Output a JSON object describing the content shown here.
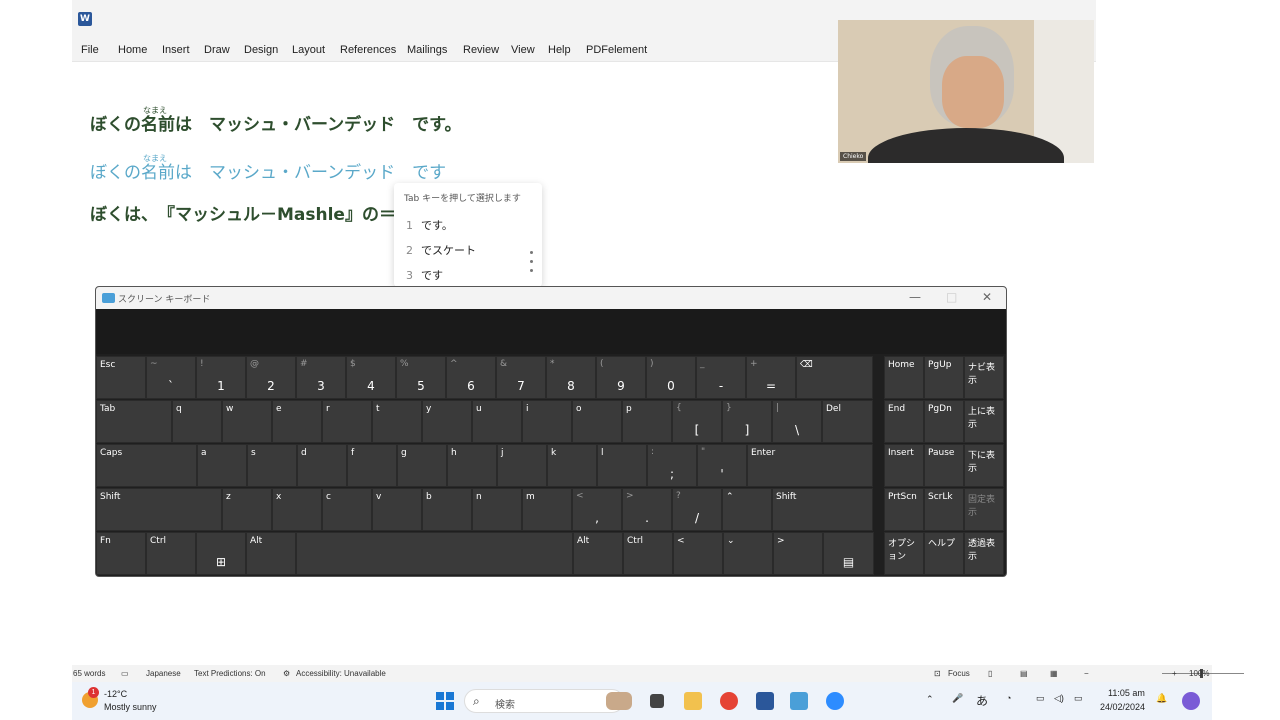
{
  "ribbon": {
    "tabs": [
      "File",
      "Home",
      "Insert",
      "Draw",
      "Design",
      "Layout",
      "References",
      "Mailings",
      "Review",
      "View",
      "Help",
      "PDFelement"
    ]
  },
  "document": {
    "line1": {
      "a": "ぼくの",
      "b": "名前",
      "c": "は　マッシュ・バーンデッド　です。",
      "ruby": "なまえ"
    },
    "line2": {
      "a": "ぼくの",
      "b": "名前",
      "c": "は　マッシュ・バーンデッド　",
      "d": "です",
      "ruby": "なまえ"
    },
    "line3": {
      "text": "ぼくは、　『マッシュル－Mashle』の＝"
    }
  },
  "ime": {
    "hint": "Tab キーを押して選択します",
    "candidates": [
      {
        "num": "1",
        "text": "です。"
      },
      {
        "num": "2",
        "text": "でスケート"
      },
      {
        "num": "3",
        "text": "です"
      }
    ]
  },
  "video": {
    "name": "Chieko"
  },
  "keyboard": {
    "title": "スクリーン キーボード",
    "controls": {
      "minimize": "—",
      "maximize": "□",
      "close": "✕"
    },
    "row1": [
      {
        "up": "",
        "main": "",
        "lbl": "Esc"
      },
      {
        "up": "~",
        "main": "`",
        "lbl": ""
      },
      {
        "up": "!",
        "main": "1",
        "lbl": ""
      },
      {
        "up": "@",
        "main": "2",
        "lbl": ""
      },
      {
        "up": "#",
        "main": "3",
        "lbl": ""
      },
      {
        "up": "$",
        "main": "4",
        "lbl": ""
      },
      {
        "up": "%",
        "main": "5",
        "lbl": ""
      },
      {
        "up": "^",
        "main": "6",
        "lbl": ""
      },
      {
        "up": "&",
        "main": "7",
        "lbl": ""
      },
      {
        "up": "*",
        "main": "8",
        "lbl": ""
      },
      {
        "up": "(",
        "main": "9",
        "lbl": ""
      },
      {
        "up": ")",
        "main": "0",
        "lbl": ""
      },
      {
        "up": "_",
        "main": "-",
        "lbl": ""
      },
      {
        "up": "+",
        "main": "=",
        "lbl": ""
      },
      {
        "up": "",
        "main": "",
        "lbl": "⌫"
      }
    ],
    "row2": [
      {
        "up": "",
        "main": "",
        "lbl": "Tab"
      },
      {
        "up": "",
        "main": "",
        "lbl": "q"
      },
      {
        "up": "",
        "main": "",
        "lbl": "w"
      },
      {
        "up": "",
        "main": "",
        "lbl": "e"
      },
      {
        "up": "",
        "main": "",
        "lbl": "r"
      },
      {
        "up": "",
        "main": "",
        "lbl": "t"
      },
      {
        "up": "",
        "main": "",
        "lbl": "y"
      },
      {
        "up": "",
        "main": "",
        "lbl": "u"
      },
      {
        "up": "",
        "main": "",
        "lbl": "i"
      },
      {
        "up": "",
        "main": "",
        "lbl": "o"
      },
      {
        "up": "",
        "main": "",
        "lbl": "p"
      },
      {
        "up": "{",
        "main": "[",
        "lbl": ""
      },
      {
        "up": "}",
        "main": "]",
        "lbl": ""
      },
      {
        "up": "|",
        "main": "\\",
        "lbl": ""
      },
      {
        "up": "",
        "main": "",
        "lbl": "Del"
      }
    ],
    "row3": [
      {
        "up": "",
        "main": "",
        "lbl": "Caps"
      },
      {
        "up": "",
        "main": "",
        "lbl": "a"
      },
      {
        "up": "",
        "main": "",
        "lbl": "s"
      },
      {
        "up": "",
        "main": "",
        "lbl": "d"
      },
      {
        "up": "",
        "main": "",
        "lbl": "f"
      },
      {
        "up": "",
        "main": "",
        "lbl": "g"
      },
      {
        "up": "",
        "main": "",
        "lbl": "h"
      },
      {
        "up": "",
        "main": "",
        "lbl": "j"
      },
      {
        "up": "",
        "main": "",
        "lbl": "k"
      },
      {
        "up": "",
        "main": "",
        "lbl": "l"
      },
      {
        "up": ":",
        "main": ";",
        "lbl": ""
      },
      {
        "up": "\"",
        "main": "'",
        "lbl": ""
      },
      {
        "up": "",
        "main": "",
        "lbl": "Enter"
      }
    ],
    "row4": [
      {
        "up": "",
        "main": "",
        "lbl": "Shift"
      },
      {
        "up": "",
        "main": "",
        "lbl": "z"
      },
      {
        "up": "",
        "main": "",
        "lbl": "x"
      },
      {
        "up": "",
        "main": "",
        "lbl": "c"
      },
      {
        "up": "",
        "main": "",
        "lbl": "v"
      },
      {
        "up": "",
        "main": "",
        "lbl": "b"
      },
      {
        "up": "",
        "main": "",
        "lbl": "n"
      },
      {
        "up": "",
        "main": "",
        "lbl": "m"
      },
      {
        "up": "<",
        "main": ",",
        "lbl": ""
      },
      {
        "up": ">",
        "main": ".",
        "lbl": ""
      },
      {
        "up": "?",
        "main": "/",
        "lbl": ""
      },
      {
        "up": "",
        "main": "",
        "lbl": "⌃"
      },
      {
        "up": "",
        "main": "",
        "lbl": "Shift"
      }
    ],
    "row5": [
      {
        "up": "",
        "main": "",
        "lbl": "Fn"
      },
      {
        "up": "",
        "main": "",
        "lbl": "Ctrl"
      },
      {
        "up": "",
        "main": "⊞",
        "lbl": ""
      },
      {
        "up": "",
        "main": "",
        "lbl": "Alt"
      },
      {
        "up": "",
        "main": "",
        "lbl": ""
      },
      {
        "up": "",
        "main": "",
        "lbl": "Alt"
      },
      {
        "up": "",
        "main": "",
        "lbl": "Ctrl"
      },
      {
        "up": "",
        "main": "",
        "lbl": "<"
      },
      {
        "up": "",
        "main": "",
        "lbl": "⌄"
      },
      {
        "up": "",
        "main": "",
        "lbl": ">"
      },
      {
        "up": "",
        "main": "▤",
        "lbl": ""
      }
    ],
    "nav": [
      [
        "Home",
        "PgUp",
        "ナビ表示"
      ],
      [
        "End",
        "PgDn",
        "上に表示"
      ],
      [
        "Insert",
        "Pause",
        "下に表示"
      ],
      [
        "PrtScn",
        "ScrLk",
        "固定表示"
      ],
      [
        "オプション",
        "ヘルプ",
        "透過表示"
      ]
    ]
  },
  "status": {
    "words": "65 words",
    "language": "Japanese",
    "predictions": "Text Predictions: On",
    "accessibility": "Accessibility: Unavailable",
    "focus": "Focus",
    "zoom": "100%"
  },
  "taskbar": {
    "badge": "1",
    "temp": "-12°C",
    "weather": "Mostly sunny",
    "search": "検索",
    "time": "11:05 am",
    "date": "24/02/2024",
    "ime": "あ"
  }
}
